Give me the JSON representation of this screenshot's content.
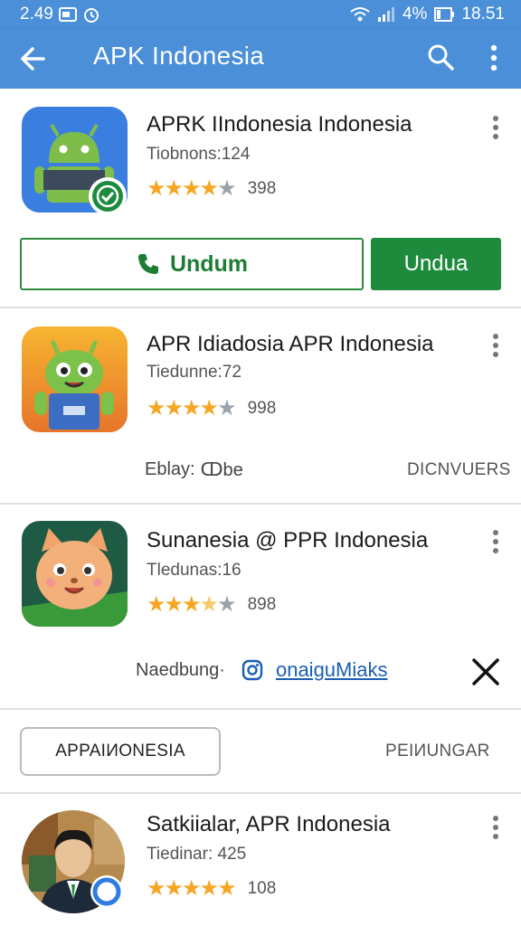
{
  "status_bar": {
    "time": "2.49",
    "battery": "4%",
    "clock": "18.51"
  },
  "app_bar": {
    "title": "APK  Indonesia"
  },
  "apps": [
    {
      "name": "APRK IIndonesia Indonesia",
      "subtitle": "Tiobnons:124",
      "rating": 4,
      "rating_count": "398",
      "icon": "android-robot-icon"
    },
    {
      "name": "APR Idiadosia APR Indonesia",
      "subtitle": "Tiedunne:72",
      "rating": 4,
      "rating_count": "998",
      "icon": "green-alien-icon"
    },
    {
      "name": "Sunanesia @ PPR Indonesia",
      "subtitle": "Tledunas:16",
      "rating": 3.5,
      "rating_count": "898",
      "icon": "cartoon-cat-icon"
    },
    {
      "name": "Satkiialar, APR Indonesia",
      "subtitle": "Tiedinar: 425",
      "rating": 5,
      "rating_count": "108",
      "icon": "person-photo-icon"
    }
  ],
  "buttons": {
    "undum": "Undum",
    "undua": "Undua"
  },
  "card2": {
    "meta_left": "Eblay:",
    "meta_value": "ↀbe",
    "meta_right": "DICNVUERS"
  },
  "card3": {
    "meta_left": "Naedbung·",
    "link": "onaiguMiaks"
  },
  "section": {
    "chip": "APPAIИONESIA",
    "right": "PEIИUNGAR"
  }
}
